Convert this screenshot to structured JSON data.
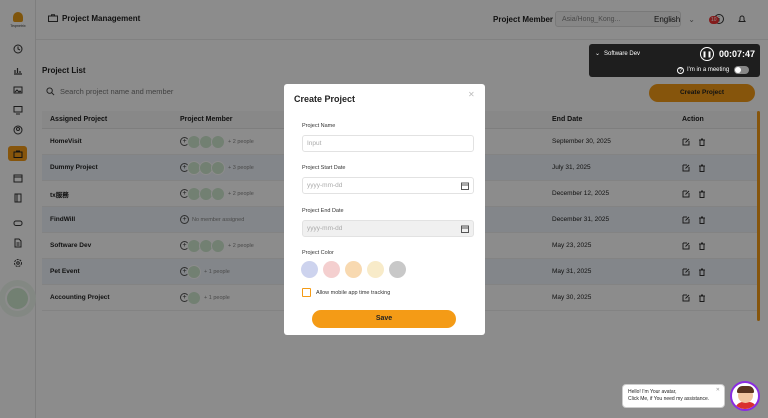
{
  "app": {
    "logo_text": "Teqmetrix",
    "header_title": "Project Management",
    "project_member_label": "Project Member",
    "timezone_value": "Asia/Hong_Kong...",
    "language": "English",
    "notification_count": "10"
  },
  "page": {
    "title": "Project List",
    "search_placeholder": "Search project name and member",
    "create_button": "Create Project"
  },
  "table": {
    "headers": [
      "Assigned Project",
      "Project Member",
      "End Date",
      "Action"
    ],
    "rows": [
      {
        "name": "HomeVisit",
        "members": "+ 2 people",
        "end_date": "September 30, 2025"
      },
      {
        "name": "Dummy Project",
        "members": "+ 3 people",
        "end_date": "July 31, 2025"
      },
      {
        "name": "tx服務",
        "members": "+ 2 people",
        "end_date": "December 12, 2025"
      },
      {
        "name": "FindWill",
        "members": "No member assigned",
        "end_date": "December 31, 2025"
      },
      {
        "name": "Software Dev",
        "members": "+ 2 people",
        "end_date": "May 23, 2025"
      },
      {
        "name": "Pet Event",
        "members": "+ 1 people",
        "end_date": "May 31, 2025"
      },
      {
        "name": "Accounting Project",
        "members": "+ 1 people",
        "end_date": "May 30, 2025"
      }
    ]
  },
  "timer": {
    "project": "Software Dev",
    "time": "00:07:47",
    "meeting_label": "I'm in a meeting"
  },
  "modal": {
    "title": "Create Project",
    "name_label": "Project Name",
    "name_placeholder": "Input",
    "start_label": "Project Start Date",
    "start_placeholder": "yyyy-mm-dd",
    "end_label": "Project End Date",
    "end_placeholder": "yyyy-mm-dd",
    "color_label": "Project Color",
    "colors": [
      "#cdd3ee",
      "#f4cfcf",
      "#f8d9b0",
      "#f8ebc9",
      "#c8c8c8"
    ],
    "checkbox_label": "Allow mobile app time tracking",
    "save_button": "Save"
  },
  "assistant": {
    "line1": "Hello! I'm Your avatar,",
    "line2": "Click Me, if You need my assistance."
  },
  "accent_color": "#f49b16"
}
